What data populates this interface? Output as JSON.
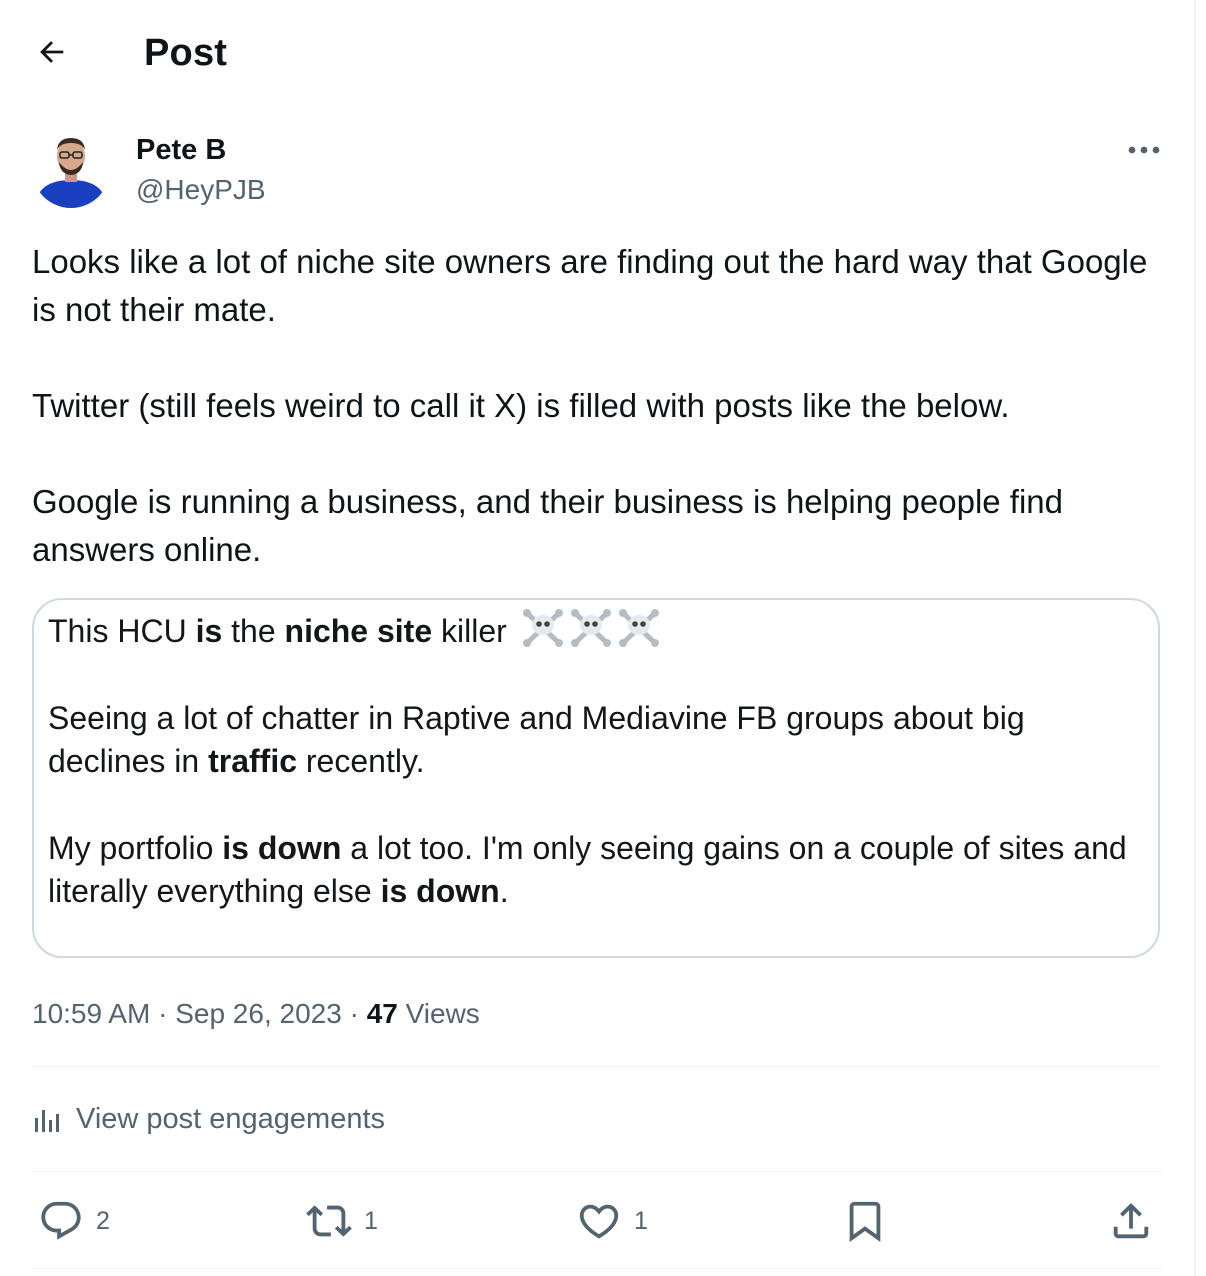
{
  "header": {
    "title": "Post",
    "back_icon": "arrow-left-icon"
  },
  "author": {
    "name": "Pete B",
    "handle": "@HeyPJB",
    "avatar_accent": "#1a3fc1",
    "more_icon": "more-horizontal-icon"
  },
  "post": {
    "paragraphs": [
      "Looks like a lot of niche site owners are finding out the hard way that Google is not their mate.",
      "Twitter (still feels weird to call it X) is filled with posts like the below.",
      "Google is running a business, and their business is helping people find answers online."
    ]
  },
  "media": {
    "line1": {
      "a": "This HCU ",
      "b_bold": "is",
      "c": " the ",
      "d_bold": "niche site",
      "e": " killer",
      "emoji_icons": [
        "skull-crossbones-icon",
        "skull-crossbones-icon",
        "skull-crossbones-icon"
      ]
    },
    "line2": {
      "a": "Seeing a lot of chatter in Raptive and Mediavine FB groups about big declines in ",
      "b_bold": "traffic",
      "c": " recently."
    },
    "line3": {
      "a": "My portfolio ",
      "b_bold": "is down",
      "c": " a lot too. I'm only seeing gains on a couple of sites and literally everything else ",
      "d_bold": "is down",
      "e": "."
    }
  },
  "meta": {
    "time": "10:59 AM",
    "separator": " · ",
    "date": "Sep 26, 2023",
    "views_count": "47",
    "views_label": " Views"
  },
  "engagements": {
    "label": "View post engagements",
    "icon": "bar-chart-icon"
  },
  "actions": {
    "reply": {
      "icon": "reply-icon",
      "count": "2"
    },
    "repost": {
      "icon": "repost-icon",
      "count": "1"
    },
    "like": {
      "icon": "heart-icon",
      "count": "1"
    },
    "bookmark": {
      "icon": "bookmark-icon"
    },
    "share": {
      "icon": "share-icon"
    }
  },
  "colors": {
    "text": "#0f1419",
    "secondary": "#536471",
    "border": "#cfd9de",
    "divider": "#eff3f4"
  }
}
